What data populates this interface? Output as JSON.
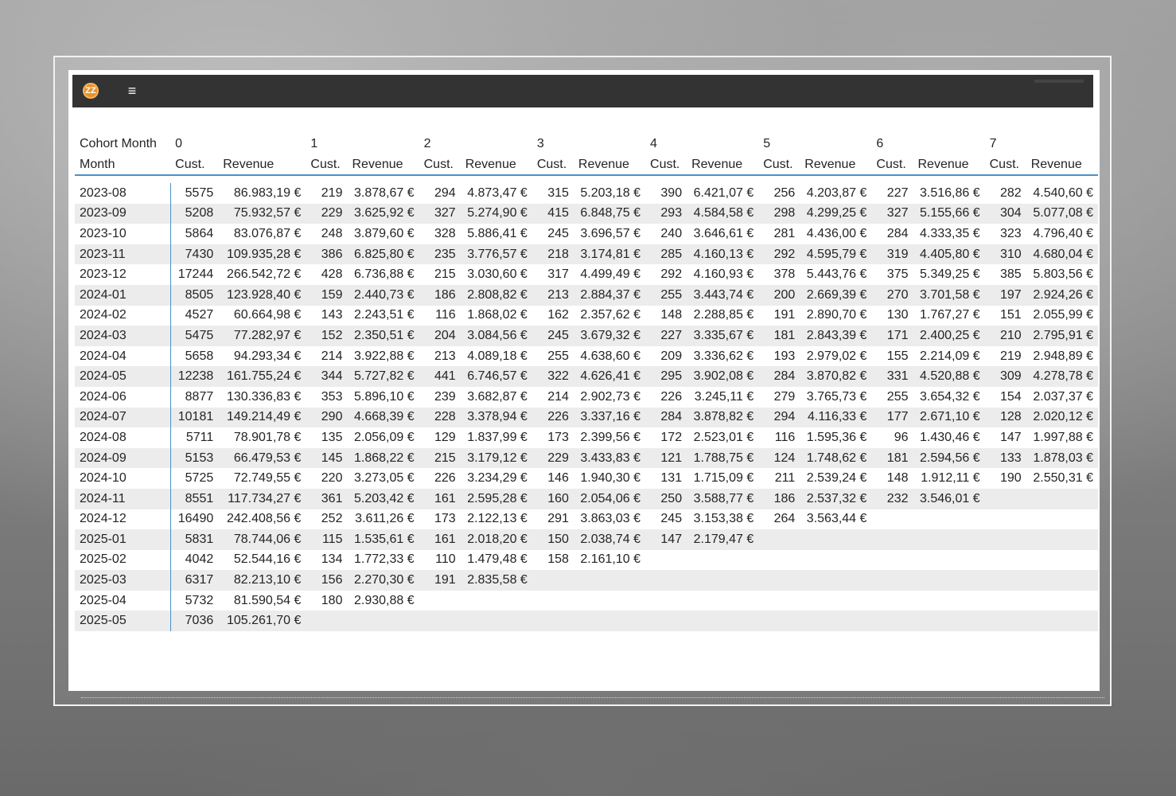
{
  "app": {
    "logo_text": "ZZ",
    "menu_icon": "hamburger-icon"
  },
  "matrix": {
    "row_header_top": "Cohort Month",
    "row_header_bottom": "Month",
    "groups": [
      "0",
      "1",
      "2",
      "3",
      "4",
      "5",
      "6",
      "7"
    ],
    "col_labels": {
      "cust": "Cust.",
      "revenue": "Revenue"
    },
    "rows": [
      {
        "month": "2023-08",
        "cells": [
          [
            "5575",
            "86.983,19 €"
          ],
          [
            "219",
            "3.878,67 €"
          ],
          [
            "294",
            "4.873,47 €"
          ],
          [
            "315",
            "5.203,18 €"
          ],
          [
            "390",
            "6.421,07 €"
          ],
          [
            "256",
            "4.203,87 €"
          ],
          [
            "227",
            "3.516,86 €"
          ],
          [
            "282",
            "4.540,60 €"
          ]
        ]
      },
      {
        "month": "2023-09",
        "cells": [
          [
            "5208",
            "75.932,57 €"
          ],
          [
            "229",
            "3.625,92 €"
          ],
          [
            "327",
            "5.274,90 €"
          ],
          [
            "415",
            "6.848,75 €"
          ],
          [
            "293",
            "4.584,58 €"
          ],
          [
            "298",
            "4.299,25 €"
          ],
          [
            "327",
            "5.155,66 €"
          ],
          [
            "304",
            "5.077,08 €"
          ]
        ]
      },
      {
        "month": "2023-10",
        "cells": [
          [
            "5864",
            "83.076,87 €"
          ],
          [
            "248",
            "3.879,60 €"
          ],
          [
            "328",
            "5.886,41 €"
          ],
          [
            "245",
            "3.696,57 €"
          ],
          [
            "240",
            "3.646,61 €"
          ],
          [
            "281",
            "4.436,00 €"
          ],
          [
            "284",
            "4.333,35 €"
          ],
          [
            "323",
            "4.796,40 €"
          ]
        ]
      },
      {
        "month": "2023-11",
        "cells": [
          [
            "7430",
            "109.935,28 €"
          ],
          [
            "386",
            "6.825,80 €"
          ],
          [
            "235",
            "3.776,57 €"
          ],
          [
            "218",
            "3.174,81 €"
          ],
          [
            "285",
            "4.160,13 €"
          ],
          [
            "292",
            "4.595,79 €"
          ],
          [
            "319",
            "4.405,80 €"
          ],
          [
            "310",
            "4.680,04 €"
          ]
        ]
      },
      {
        "month": "2023-12",
        "cells": [
          [
            "17244",
            "266.542,72 €"
          ],
          [
            "428",
            "6.736,88 €"
          ],
          [
            "215",
            "3.030,60 €"
          ],
          [
            "317",
            "4.499,49 €"
          ],
          [
            "292",
            "4.160,93 €"
          ],
          [
            "378",
            "5.443,76 €"
          ],
          [
            "375",
            "5.349,25 €"
          ],
          [
            "385",
            "5.803,56 €"
          ]
        ]
      },
      {
        "month": "2024-01",
        "cells": [
          [
            "8505",
            "123.928,40 €"
          ],
          [
            "159",
            "2.440,73 €"
          ],
          [
            "186",
            "2.808,82 €"
          ],
          [
            "213",
            "2.884,37 €"
          ],
          [
            "255",
            "3.443,74 €"
          ],
          [
            "200",
            "2.669,39 €"
          ],
          [
            "270",
            "3.701,58 €"
          ],
          [
            "197",
            "2.924,26 €"
          ]
        ]
      },
      {
        "month": "2024-02",
        "cells": [
          [
            "4527",
            "60.664,98 €"
          ],
          [
            "143",
            "2.243,51 €"
          ],
          [
            "116",
            "1.868,02 €"
          ],
          [
            "162",
            "2.357,62 €"
          ],
          [
            "148",
            "2.288,85 €"
          ],
          [
            "191",
            "2.890,70 €"
          ],
          [
            "130",
            "1.767,27 €"
          ],
          [
            "151",
            "2.055,99 €"
          ]
        ]
      },
      {
        "month": "2024-03",
        "cells": [
          [
            "5475",
            "77.282,97 €"
          ],
          [
            "152",
            "2.350,51 €"
          ],
          [
            "204",
            "3.084,56 €"
          ],
          [
            "245",
            "3.679,32 €"
          ],
          [
            "227",
            "3.335,67 €"
          ],
          [
            "181",
            "2.843,39 €"
          ],
          [
            "171",
            "2.400,25 €"
          ],
          [
            "210",
            "2.795,91 €"
          ]
        ]
      },
      {
        "month": "2024-04",
        "cells": [
          [
            "5658",
            "94.293,34 €"
          ],
          [
            "214",
            "3.922,88 €"
          ],
          [
            "213",
            "4.089,18 €"
          ],
          [
            "255",
            "4.638,60 €"
          ],
          [
            "209",
            "3.336,62 €"
          ],
          [
            "193",
            "2.979,02 €"
          ],
          [
            "155",
            "2.214,09 €"
          ],
          [
            "219",
            "2.948,89 €"
          ]
        ]
      },
      {
        "month": "2024-05",
        "cells": [
          [
            "12238",
            "161.755,24 €"
          ],
          [
            "344",
            "5.727,82 €"
          ],
          [
            "441",
            "6.746,57 €"
          ],
          [
            "322",
            "4.626,41 €"
          ],
          [
            "295",
            "3.902,08 €"
          ],
          [
            "284",
            "3.870,82 €"
          ],
          [
            "331",
            "4.520,88 €"
          ],
          [
            "309",
            "4.278,78 €"
          ]
        ]
      },
      {
        "month": "2024-06",
        "cells": [
          [
            "8877",
            "130.336,83 €"
          ],
          [
            "353",
            "5.896,10 €"
          ],
          [
            "239",
            "3.682,87 €"
          ],
          [
            "214",
            "2.902,73 €"
          ],
          [
            "226",
            "3.245,11 €"
          ],
          [
            "279",
            "3.765,73 €"
          ],
          [
            "255",
            "3.654,32 €"
          ],
          [
            "154",
            "2.037,37 €"
          ]
        ]
      },
      {
        "month": "2024-07",
        "cells": [
          [
            "10181",
            "149.214,49 €"
          ],
          [
            "290",
            "4.668,39 €"
          ],
          [
            "228",
            "3.378,94 €"
          ],
          [
            "226",
            "3.337,16 €"
          ],
          [
            "284",
            "3.878,82 €"
          ],
          [
            "294",
            "4.116,33 €"
          ],
          [
            "177",
            "2.671,10 €"
          ],
          [
            "128",
            "2.020,12 €"
          ]
        ]
      },
      {
        "month": "2024-08",
        "cells": [
          [
            "5711",
            "78.901,78 €"
          ],
          [
            "135",
            "2.056,09 €"
          ],
          [
            "129",
            "1.837,99 €"
          ],
          [
            "173",
            "2.399,56 €"
          ],
          [
            "172",
            "2.523,01 €"
          ],
          [
            "116",
            "1.595,36 €"
          ],
          [
            "96",
            "1.430,46 €"
          ],
          [
            "147",
            "1.997,88 €"
          ]
        ]
      },
      {
        "month": "2024-09",
        "cells": [
          [
            "5153",
            "66.479,53 €"
          ],
          [
            "145",
            "1.868,22 €"
          ],
          [
            "215",
            "3.179,12 €"
          ],
          [
            "229",
            "3.433,83 €"
          ],
          [
            "121",
            "1.788,75 €"
          ],
          [
            "124",
            "1.748,62 €"
          ],
          [
            "181",
            "2.594,56 €"
          ],
          [
            "133",
            "1.878,03 €"
          ]
        ]
      },
      {
        "month": "2024-10",
        "cells": [
          [
            "5725",
            "72.749,55 €"
          ],
          [
            "220",
            "3.273,05 €"
          ],
          [
            "226",
            "3.234,29 €"
          ],
          [
            "146",
            "1.940,30 €"
          ],
          [
            "131",
            "1.715,09 €"
          ],
          [
            "211",
            "2.539,24 €"
          ],
          [
            "148",
            "1.912,11 €"
          ],
          [
            "190",
            "2.550,31 €"
          ]
        ]
      },
      {
        "month": "2024-11",
        "cells": [
          [
            "8551",
            "117.734,27 €"
          ],
          [
            "361",
            "5.203,42 €"
          ],
          [
            "161",
            "2.595,28 €"
          ],
          [
            "160",
            "2.054,06 €"
          ],
          [
            "250",
            "3.588,77 €"
          ],
          [
            "186",
            "2.537,32 €"
          ],
          [
            "232",
            "3.546,01 €"
          ],
          [
            "",
            ""
          ]
        ]
      },
      {
        "month": "2024-12",
        "cells": [
          [
            "16490",
            "242.408,56 €"
          ],
          [
            "252",
            "3.611,26 €"
          ],
          [
            "173",
            "2.122,13 €"
          ],
          [
            "291",
            "3.863,03 €"
          ],
          [
            "245",
            "3.153,38 €"
          ],
          [
            "264",
            "3.563,44 €"
          ],
          [
            "",
            ""
          ],
          [
            "",
            ""
          ]
        ]
      },
      {
        "month": "2025-01",
        "cells": [
          [
            "5831",
            "78.744,06 €"
          ],
          [
            "115",
            "1.535,61 €"
          ],
          [
            "161",
            "2.018,20 €"
          ],
          [
            "150",
            "2.038,74 €"
          ],
          [
            "147",
            "2.179,47 €"
          ],
          [
            "",
            ""
          ],
          [
            "",
            ""
          ],
          [
            "",
            ""
          ]
        ]
      },
      {
        "month": "2025-02",
        "cells": [
          [
            "4042",
            "52.544,16 €"
          ],
          [
            "134",
            "1.772,33 €"
          ],
          [
            "110",
            "1.479,48 €"
          ],
          [
            "158",
            "2.161,10 €"
          ],
          [
            "",
            ""
          ],
          [
            "",
            ""
          ],
          [
            "",
            ""
          ],
          [
            "",
            ""
          ]
        ]
      },
      {
        "month": "2025-03",
        "cells": [
          [
            "6317",
            "82.213,10 €"
          ],
          [
            "156",
            "2.270,30 €"
          ],
          [
            "191",
            "2.835,58 €"
          ],
          [
            "",
            ""
          ],
          [
            "",
            ""
          ],
          [
            "",
            ""
          ],
          [
            "",
            ""
          ],
          [
            "",
            ""
          ]
        ]
      },
      {
        "month": "2025-04",
        "cells": [
          [
            "5732",
            "81.590,54 €"
          ],
          [
            "180",
            "2.930,88 €"
          ],
          [
            "",
            ""
          ],
          [
            "",
            ""
          ],
          [
            "",
            ""
          ],
          [
            "",
            ""
          ],
          [
            "",
            ""
          ],
          [
            "",
            ""
          ]
        ]
      },
      {
        "month": "2025-05",
        "cells": [
          [
            "7036",
            "105.261,70 €"
          ],
          [
            "",
            ""
          ],
          [
            "",
            ""
          ],
          [
            "",
            ""
          ],
          [
            "",
            ""
          ],
          [
            "",
            ""
          ],
          [
            "",
            ""
          ],
          [
            "",
            ""
          ]
        ]
      }
    ]
  }
}
